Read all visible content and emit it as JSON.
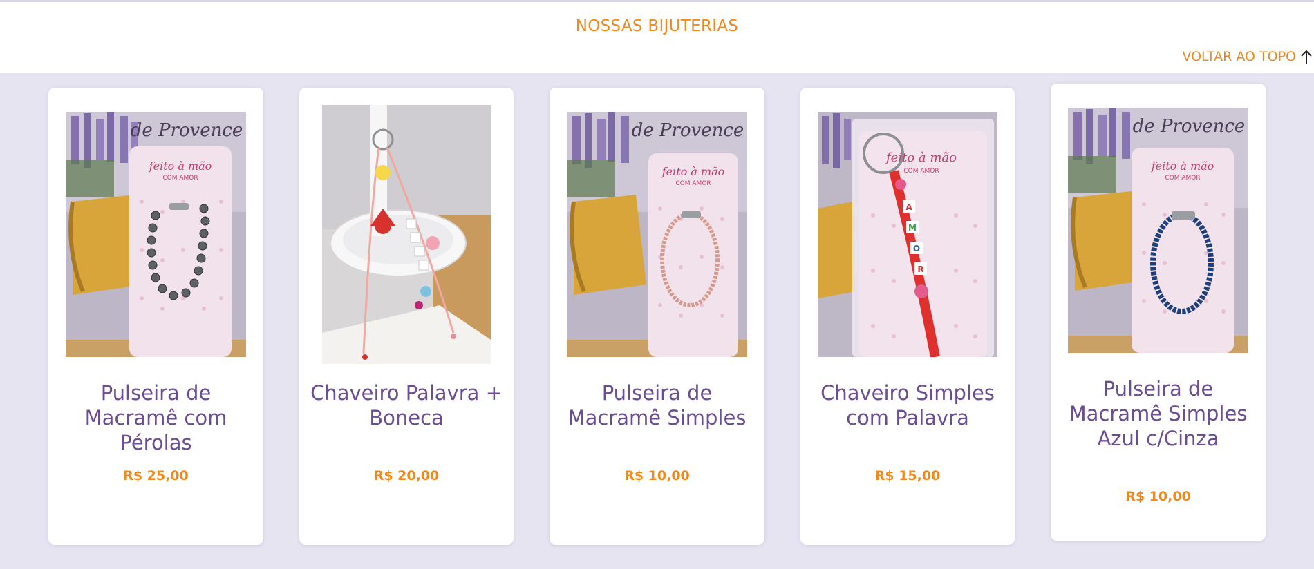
{
  "section_title": "NOSSAS BIJUTERIAS",
  "back_to_top_label": "VOLTAR AO TOPO",
  "colors": {
    "accent": "#f0891c",
    "product_name": "#6a4d94",
    "page_background": "#e7e4f2"
  },
  "products": [
    {
      "name": "Pulseira de Macramê com Pérolas",
      "price": "R$ 25,00",
      "image": "bracelet-pearls-photo",
      "image_text": {
        "brand": "feito à mão",
        "tagline": "COM AMOR",
        "background": "de Provence"
      }
    },
    {
      "name": "Chaveiro Palavra + Boneca",
      "price": "R$ 20,00",
      "image": "keychain-doll-photo"
    },
    {
      "name": "Pulseira de Macramê Simples",
      "price": "R$ 10,00",
      "image": "bracelet-pink-photo",
      "image_text": {
        "brand": "feito à mão",
        "tagline": "COM AMOR",
        "background": "de Provence"
      }
    },
    {
      "name": "Chaveiro Simples com Palavra",
      "price": "R$ 15,00",
      "image": "keychain-amor-photo",
      "image_text": {
        "brand": "feito à mão",
        "tagline": "COM AMOR",
        "letters": [
          "A",
          "M",
          "O",
          "R"
        ]
      }
    },
    {
      "name": "Pulseira de Macramê Simples Azul c/Cinza",
      "price": "R$ 10,00",
      "image": "bracelet-blue-photo",
      "image_text": {
        "brand": "feito à mão",
        "tagline": "COM AMOR",
        "background": "de Provence"
      }
    }
  ]
}
